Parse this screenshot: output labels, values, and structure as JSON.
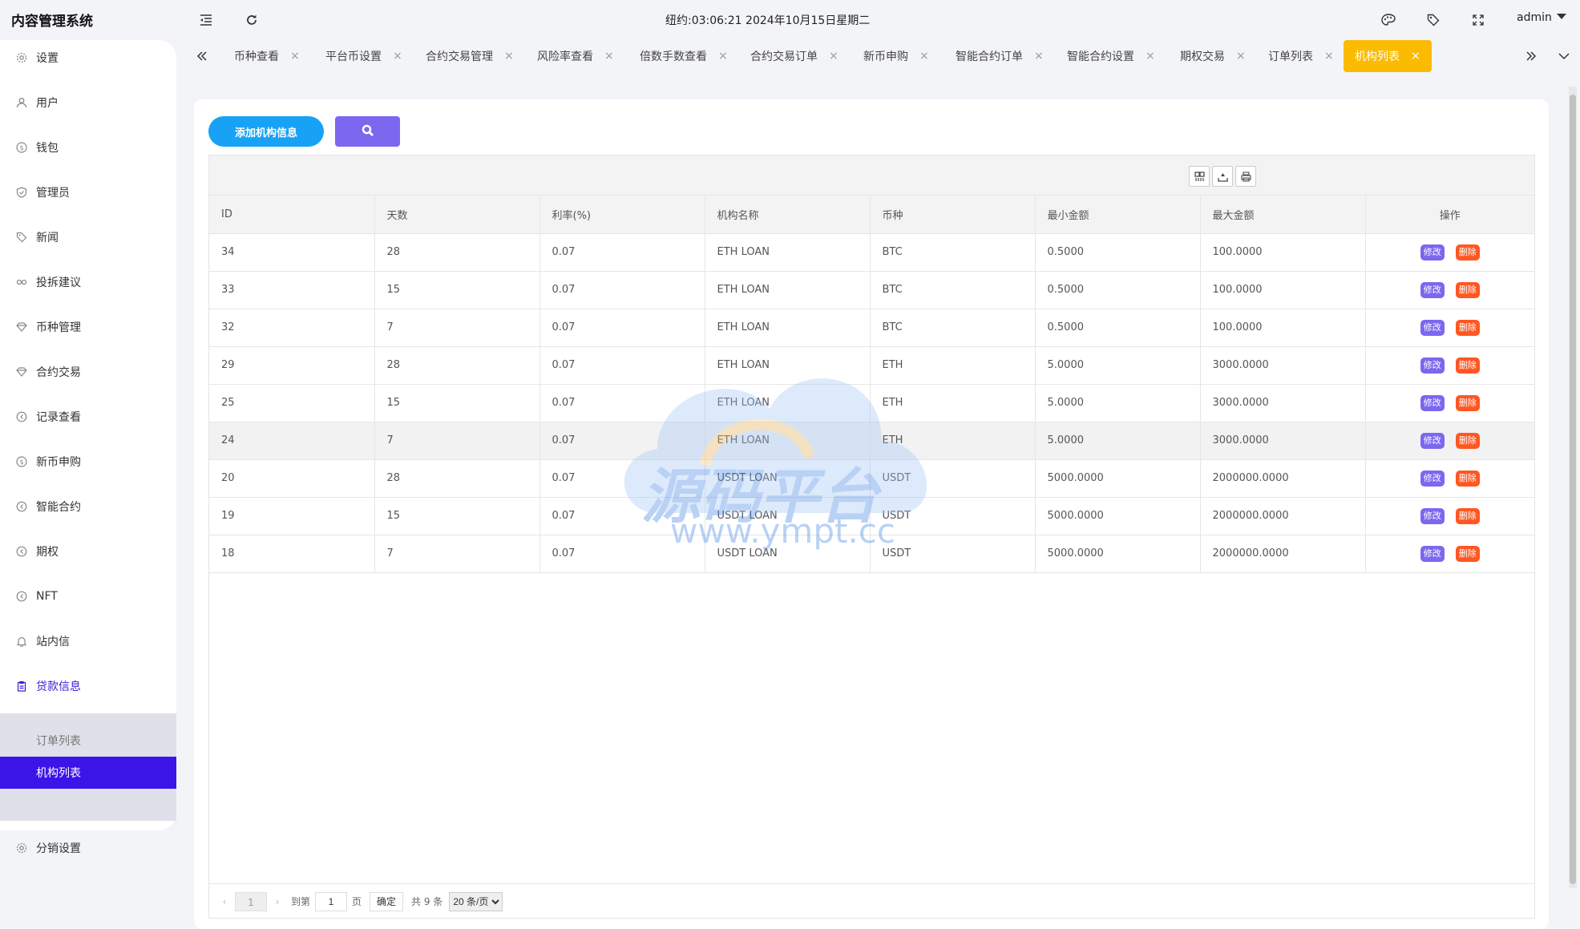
{
  "header": {
    "brand": "内容管理系统",
    "clock": "纽约:03:06:21 2024年10月15日星期二",
    "user": "admin"
  },
  "sidebar": {
    "items": [
      {
        "label": "设置",
        "icon": "gear-icon"
      },
      {
        "label": "用户",
        "icon": "user-icon"
      },
      {
        "label": "钱包",
        "icon": "dollar-icon"
      },
      {
        "label": "管理员",
        "icon": "shield-icon"
      },
      {
        "label": "新闻",
        "icon": "tag-icon"
      },
      {
        "label": "投拆建议",
        "icon": "link-icon"
      },
      {
        "label": "币种管理",
        "icon": "diamond-icon"
      },
      {
        "label": "合约交易",
        "icon": "diamond-icon"
      },
      {
        "label": "记录查看",
        "icon": "circle-arrow-icon"
      },
      {
        "label": "新币申购",
        "icon": "dollar-icon"
      },
      {
        "label": "智能合约",
        "icon": "circle-arrow-icon"
      },
      {
        "label": "期权",
        "icon": "circle-arrow-icon"
      },
      {
        "label": "NFT",
        "icon": "circle-arrow-icon"
      },
      {
        "label": "站内信",
        "icon": "bell-icon"
      },
      {
        "label": "贷款信息",
        "icon": "clipboard-icon"
      }
    ],
    "submenu": [
      {
        "label": "订单列表"
      },
      {
        "label": "机构列表"
      }
    ],
    "last_item": {
      "label": "分销设置",
      "icon": "gear-icon"
    }
  },
  "tabs": [
    "币种查看",
    "平台币设置",
    "合约交易管理",
    "风险率查看",
    "倍数手数查看",
    "合约交易订单",
    "新币申购",
    "智能合约订单",
    "智能合约设置",
    "期权交易",
    "订单列表",
    "机构列表"
  ],
  "tab_close": "×",
  "toolbar": {
    "add_label": "添加机构信息"
  },
  "table": {
    "headers": [
      "ID",
      "天数",
      "利率(%)",
      "机构名称",
      "币种",
      "最小金额",
      "最大金额",
      "操作"
    ],
    "rows": [
      [
        "34",
        "28",
        "0.07",
        "ETH LOAN",
        "BTC",
        "0.5000",
        "100.0000"
      ],
      [
        "33",
        "15",
        "0.07",
        "ETH LOAN",
        "BTC",
        "0.5000",
        "100.0000"
      ],
      [
        "32",
        "7",
        "0.07",
        "ETH LOAN",
        "BTC",
        "0.5000",
        "100.0000"
      ],
      [
        "29",
        "28",
        "0.07",
        "ETH LOAN",
        "ETH",
        "5.0000",
        "3000.0000"
      ],
      [
        "25",
        "15",
        "0.07",
        "ETH LOAN",
        "ETH",
        "5.0000",
        "3000.0000"
      ],
      [
        "24",
        "7",
        "0.07",
        "ETH LOAN",
        "ETH",
        "5.0000",
        "3000.0000"
      ],
      [
        "20",
        "28",
        "0.07",
        "USDT LOAN",
        "USDT",
        "5000.0000",
        "2000000.0000"
      ],
      [
        "19",
        "15",
        "0.07",
        "USDT LOAN",
        "USDT",
        "5000.0000",
        "2000000.0000"
      ],
      [
        "18",
        "7",
        "0.07",
        "USDT LOAN",
        "USDT",
        "5000.0000",
        "2000000.0000"
      ]
    ],
    "edit_label": "修改",
    "delete_label": "删除"
  },
  "pager": {
    "current": "1",
    "goto_label": "到第",
    "page_input": "1",
    "page_suffix": "页",
    "confirm": "确定",
    "total": "共 9 条",
    "page_size": "20 条/页"
  },
  "watermark": {
    "cn": "源码平台",
    "url": "www.ympt.cc"
  },
  "colors": {
    "accent": "#3b14e8",
    "active_tab": "#fbbb03",
    "add_button": "#17a2f5",
    "search_button": "#7b68ee",
    "edit": "#7b68ee",
    "delete": "#ff5722"
  }
}
